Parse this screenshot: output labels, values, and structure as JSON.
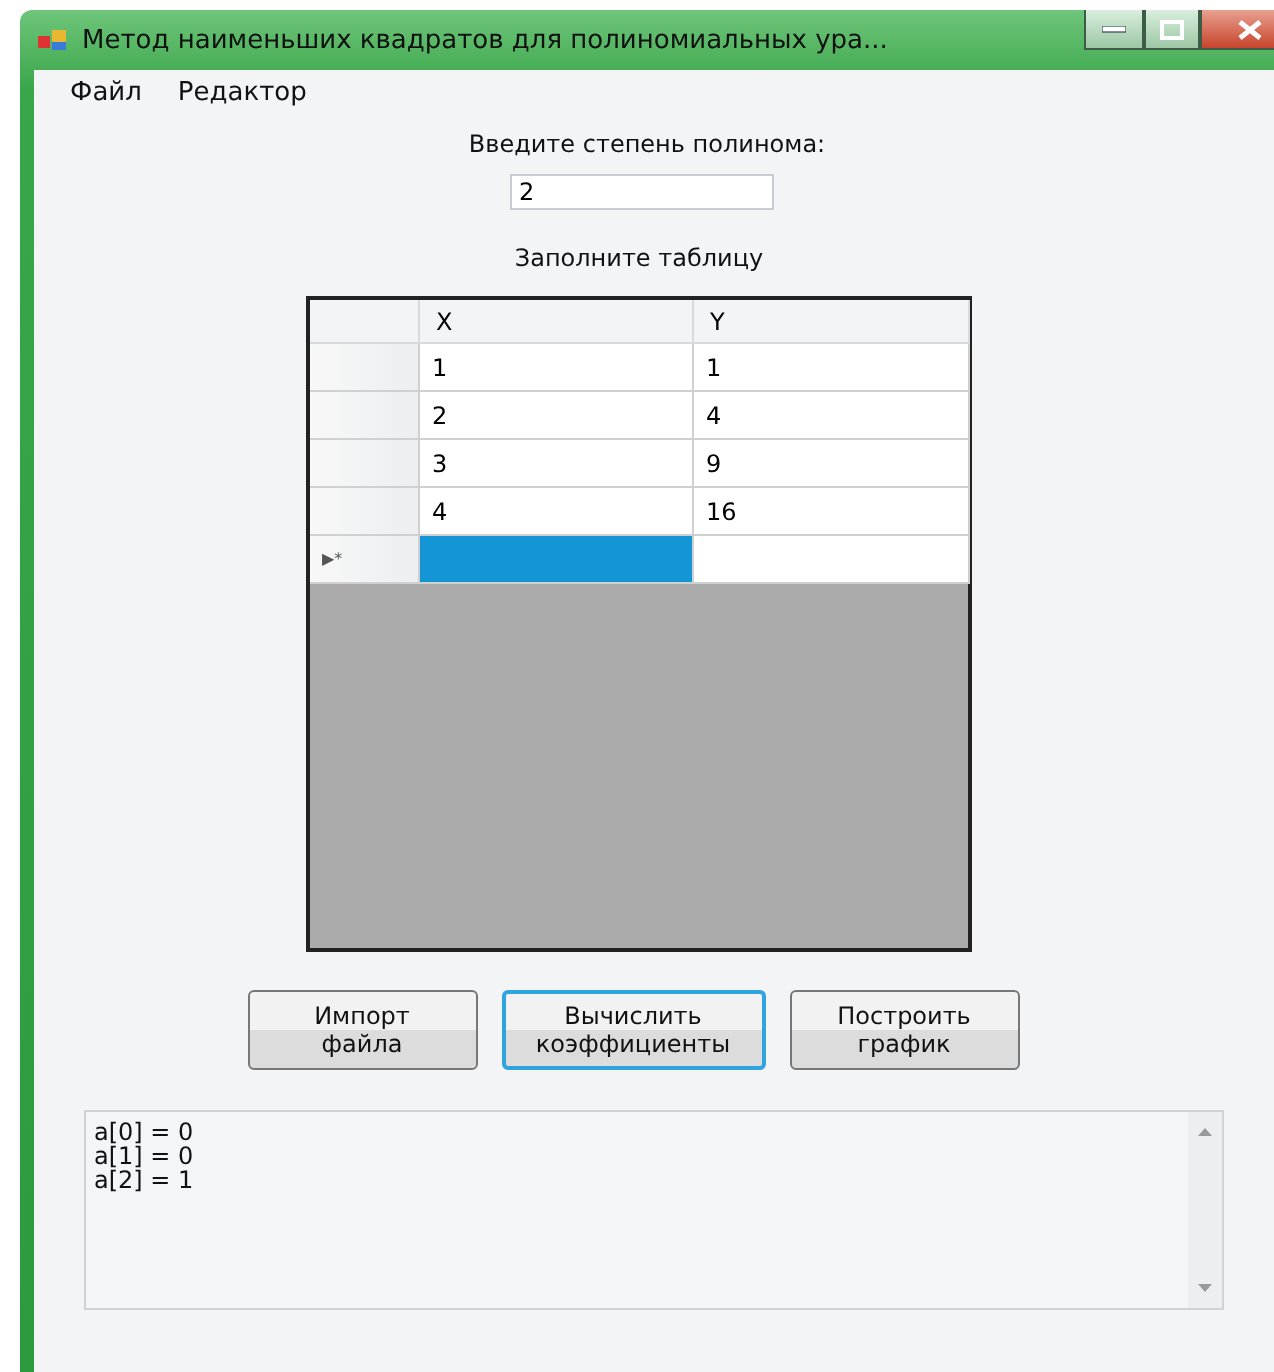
{
  "window": {
    "title": "Метод наименьших квадратов для полиномиальных ура..."
  },
  "menu": [
    {
      "label": "Файл"
    },
    {
      "label": "Редактор"
    }
  ],
  "degree": {
    "label": "Введите степень полинома:",
    "value": "2"
  },
  "table_label": "Заполните таблицу",
  "table": {
    "columns": [
      "X",
      "Y"
    ],
    "rows": [
      {
        "header": "",
        "cells": [
          {
            "value": "1",
            "selected": false
          },
          {
            "value": "1",
            "selected": false
          }
        ]
      },
      {
        "header": "",
        "cells": [
          {
            "value": "2",
            "selected": false
          },
          {
            "value": "4",
            "selected": false
          }
        ]
      },
      {
        "header": "",
        "cells": [
          {
            "value": "3",
            "selected": false
          },
          {
            "value": "9",
            "selected": false
          }
        ]
      },
      {
        "header": "",
        "cells": [
          {
            "value": "4",
            "selected": false
          },
          {
            "value": "16",
            "selected": false
          }
        ]
      },
      {
        "header": "▶*",
        "cells": [
          {
            "selected": true
          },
          {
            "selected": false
          }
        ]
      }
    ]
  },
  "buttons": [
    {
      "label": "Импорт\nфайла",
      "focused": false
    },
    {
      "label": "Вычислить\nкоэффициенты",
      "focused": true
    },
    {
      "label": "Построить\nграфик",
      "focused": false
    }
  ],
  "output": {
    "lines": [
      "a[0] = 0",
      "a[1] = 0",
      "a[2] = 1"
    ]
  }
}
